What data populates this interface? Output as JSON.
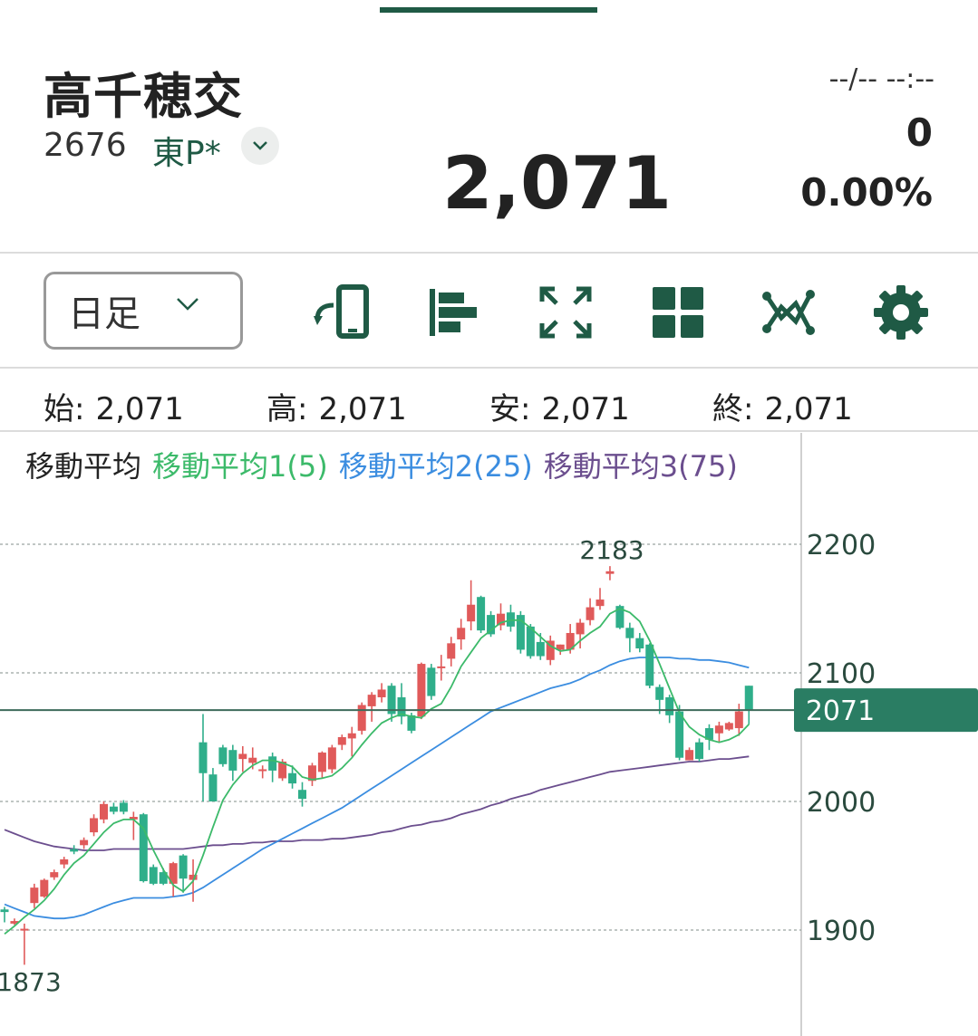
{
  "header": {
    "stock_name": "高千穂交",
    "code": "2676",
    "market": "東P*",
    "price": "2,071",
    "time": "--/-- --:--",
    "change": "0",
    "change_percent": "0.00%"
  },
  "toolbar": {
    "period": "日足",
    "icons": [
      "rotate-device-icon",
      "bar-layout-icon",
      "fullscreen-icon",
      "grid-icon",
      "indicator-icon",
      "settings-icon"
    ]
  },
  "ohlc": {
    "open_label": "始:",
    "open": "2,071",
    "high_label": "高:",
    "high": "2,071",
    "low_label": "安:",
    "low": "2,071",
    "close_label": "終:",
    "close": "2,071"
  },
  "legend": {
    "title": "移動平均",
    "ma1": "移動平均1(5)",
    "ma2": "移動平均2(25)",
    "ma3": "移動平均3(75)"
  },
  "colors": {
    "accent": "#1f5a45",
    "up": "#e05a5a",
    "down": "#2fae8a",
    "ma1": "#3cba6a",
    "ma2": "#3b8de0",
    "ma3": "#6b4e8e",
    "price_tag": "#2a7d63"
  },
  "chart_data": {
    "type": "candlestick",
    "y_ticks": [
      "2200",
      "2100",
      "2000",
      "1900"
    ],
    "ylim": [
      1820,
      2245
    ],
    "current_price": 2071,
    "current_price_label": "2071",
    "max_label": "2183",
    "min_label": "1873",
    "candles": [
      [
        1916,
        1914,
        1918,
        1906
      ],
      [
        1905,
        1907,
        1909,
        1904
      ],
      [
        1901,
        1901,
        1905,
        1873
      ],
      [
        1921,
        1933,
        1936,
        1917
      ],
      [
        1926,
        1939,
        1940,
        1925
      ],
      [
        1941,
        1945,
        1947,
        1939
      ],
      [
        1951,
        1955,
        1957,
        1948
      ],
      [
        1963,
        1961,
        1966,
        1959
      ],
      [
        1966,
        1970,
        1972,
        1963
      ],
      [
        1976,
        1987,
        1990,
        1973
      ],
      [
        1986,
        1998,
        2000,
        1983
      ],
      [
        1996,
        1992,
        1999,
        1990
      ],
      [
        1999,
        1992,
        2001,
        1990
      ],
      [
        1986,
        1988,
        1992,
        1970
      ],
      [
        1990,
        1938,
        1991,
        1937
      ],
      [
        1949,
        1936,
        1951,
        1935
      ],
      [
        1945,
        1936,
        1948,
        1935
      ],
      [
        1936,
        1952,
        1953,
        1926
      ],
      [
        1958,
        1940,
        1959,
        1929
      ],
      [
        1939,
        1943,
        1955,
        1922
      ],
      [
        2046,
        2022,
        2068,
        2000
      ],
      [
        2021,
        2000,
        2026,
        2000
      ],
      [
        2042,
        2029,
        2044,
        2027
      ],
      [
        2040,
        2024,
        2044,
        2016
      ],
      [
        2033,
        2037,
        2043,
        2023
      ],
      [
        2030,
        2034,
        2042,
        2025
      ],
      [
        2024,
        2025,
        2028,
        2018
      ],
      [
        2035,
        2024,
        2038,
        2015
      ],
      [
        2018,
        2031,
        2033,
        2016
      ],
      [
        2022,
        2014,
        2028,
        2010
      ],
      [
        2009,
        2002,
        2015,
        1996
      ],
      [
        2016,
        2028,
        2030,
        2012
      ],
      [
        2023,
        2038,
        2039,
        2018
      ],
      [
        2025,
        2042,
        2044,
        2022
      ],
      [
        2044,
        2050,
        2052,
        2040
      ],
      [
        2049,
        2053,
        2058,
        2035
      ],
      [
        2055,
        2075,
        2077,
        2052
      ],
      [
        2074,
        2083,
        2085,
        2062
      ],
      [
        2081,
        2087,
        2092,
        2077
      ],
      [
        2090,
        2068,
        2092,
        2062
      ],
      [
        2081,
        2066,
        2092,
        2060
      ],
      [
        2067,
        2055,
        2069,
        2053
      ],
      [
        2066,
        2107,
        2108,
        2064
      ],
      [
        2104,
        2082,
        2107,
        2079
      ],
      [
        2104,
        2105,
        2114,
        2094
      ],
      [
        2111,
        2123,
        2128,
        2105
      ],
      [
        2126,
        2135,
        2142,
        2118
      ],
      [
        2140,
        2153,
        2172,
        2133
      ],
      [
        2159,
        2133,
        2160,
        2131
      ],
      [
        2145,
        2130,
        2148,
        2128
      ],
      [
        2137,
        2146,
        2154,
        2133
      ],
      [
        2147,
        2136,
        2153,
        2132
      ],
      [
        2145,
        2118,
        2148,
        2115
      ],
      [
        2136,
        2113,
        2138,
        2111
      ],
      [
        2124,
        2113,
        2131,
        2110
      ],
      [
        2110,
        2125,
        2129,
        2106
      ],
      [
        2118,
        2122,
        2122,
        2114
      ],
      [
        2118,
        2131,
        2138,
        2115
      ],
      [
        2130,
        2139,
        2142,
        2119
      ],
      [
        2141,
        2151,
        2158,
        2137
      ],
      [
        2152,
        2157,
        2166,
        2149
      ],
      [
        2177,
        2179,
        2183,
        2172
      ],
      [
        2152,
        2135,
        2153,
        2134
      ],
      [
        2135,
        2127,
        2139,
        2116
      ],
      [
        2127,
        2119,
        2131,
        2116
      ],
      [
        2122,
        2090,
        2123,
        2088
      ],
      [
        2089,
        2079,
        2091,
        2068
      ],
      [
        2081,
        2067,
        2083,
        2061
      ],
      [
        2070,
        2034,
        2075,
        2032
      ],
      [
        2032,
        2040,
        2042,
        2032
      ],
      [
        2046,
        2033,
        2049,
        2031
      ],
      [
        2057,
        2048,
        2060,
        2040
      ],
      [
        2053,
        2059,
        2062,
        2046
      ],
      [
        2056,
        2061,
        2062,
        2055
      ],
      [
        2057,
        2070,
        2076,
        2051
      ],
      [
        2090,
        2071,
        2090,
        2060
      ]
    ],
    "ma5": [
      1897,
      1903,
      1910,
      1916,
      1923,
      1932,
      1943,
      1952,
      1958,
      1967,
      1976,
      1983,
      1986,
      1986,
      1979,
      1962,
      1947,
      1935,
      1930,
      1938,
      1958,
      1980,
      2001,
      2013,
      2022,
      2028,
      2032,
      2032,
      2030,
      2027,
      2019,
      2017,
      2018,
      2020,
      2026,
      2034,
      2044,
      2053,
      2061,
      2065,
      2068,
      2066,
      2065,
      2072,
      2076,
      2089,
      2105,
      2116,
      2127,
      2133,
      2139,
      2141,
      2141,
      2135,
      2128,
      2121,
      2117,
      2118,
      2125,
      2131,
      2136,
      2146,
      2150,
      2147,
      2140,
      2125,
      2107,
      2088,
      2069,
      2058,
      2052,
      2048,
      2046,
      2048,
      2052,
      2060
    ],
    "ma25": [
      1920,
      1917,
      1914,
      1911,
      1910,
      1909,
      1909,
      1910,
      1912,
      1915,
      1918,
      1921,
      1923,
      1925,
      1925,
      1925,
      1925,
      1926,
      1927,
      1929,
      1933,
      1938,
      1943,
      1948,
      1953,
      1958,
      1963,
      1967,
      1971,
      1975,
      1979,
      1983,
      1987,
      1991,
      1995,
      2000,
      2005,
      2010,
      2015,
      2020,
      2025,
      2030,
      2035,
      2040,
      2045,
      2050,
      2055,
      2060,
      2065,
      2070,
      2073,
      2076,
      2079,
      2082,
      2085,
      2088,
      2090,
      2092,
      2095,
      2099,
      2102,
      2106,
      2109,
      2111,
      2112,
      2112,
      2112,
      2112,
      2111,
      2111,
      2110,
      2110,
      2109,
      2108,
      2106,
      2104
    ],
    "ma75": [
      1978,
      1975,
      1972,
      1969,
      1967,
      1965,
      1964,
      1963,
      1962,
      1962,
      1962,
      1963,
      1963,
      1963,
      1963,
      1963,
      1963,
      1963,
      1963,
      1964,
      1965,
      1966,
      1966,
      1967,
      1967,
      1968,
      1968,
      1969,
      1969,
      1969,
      1970,
      1970,
      1970,
      1971,
      1971,
      1972,
      1973,
      1974,
      1976,
      1977,
      1979,
      1981,
      1982,
      1984,
      1985,
      1987,
      1990,
      1992,
      1994,
      1997,
      1999,
      2002,
      2004,
      2006,
      2009,
      2011,
      2013,
      2015,
      2017,
      2019,
      2021,
      2023,
      2024,
      2025,
      2026,
      2027,
      2028,
      2029,
      2030,
      2031,
      2031,
      2032,
      2033,
      2033,
      2034,
      2035
    ]
  }
}
